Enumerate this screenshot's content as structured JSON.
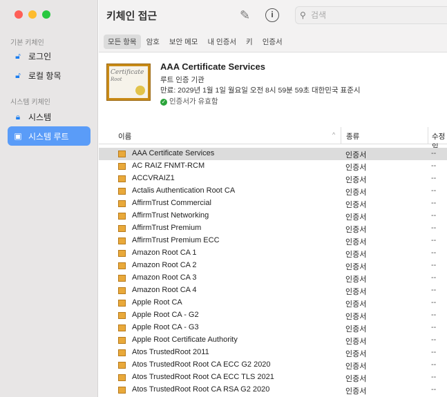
{
  "window": {
    "title": "키체인 접근",
    "search_placeholder": "검색"
  },
  "sidebar": {
    "section1": "기본 키체인",
    "items1": [
      {
        "label": "로그인",
        "icon": "lock-open-icon"
      },
      {
        "label": "로컬 항목",
        "icon": "lock-open-icon"
      }
    ],
    "section2": "시스템 키체인",
    "items2": [
      {
        "label": "시스템",
        "icon": "lock-icon"
      },
      {
        "label": "시스템 루트",
        "icon": "cabinet-icon",
        "selected": true
      }
    ]
  },
  "filters": [
    "모든 항목",
    "암호",
    "보안 메모",
    "내 인증서",
    "키",
    "인증서"
  ],
  "detail": {
    "name": "AAA Certificate Services",
    "kind": "루트 인증 기관",
    "expires": "만료: 2029년 1월 1일 월요일 오전 8시 59분 59초 대한민국 표준시",
    "status": "인증서가 유효함",
    "cert_text1": "Certificate",
    "cert_text2": "Root"
  },
  "table": {
    "columns": [
      "이름",
      "종류",
      "수정일"
    ],
    "rows": [
      [
        "AAA Certificate Services",
        "인증서",
        "--"
      ],
      [
        "AC RAIZ FNMT-RCM",
        "인증서",
        "--"
      ],
      [
        "ACCVRAIZ1",
        "인증서",
        "--"
      ],
      [
        "Actalis Authentication Root CA",
        "인증서",
        "--"
      ],
      [
        "AffirmTrust Commercial",
        "인증서",
        "--"
      ],
      [
        "AffirmTrust Networking",
        "인증서",
        "--"
      ],
      [
        "AffirmTrust Premium",
        "인증서",
        "--"
      ],
      [
        "AffirmTrust Premium ECC",
        "인증서",
        "--"
      ],
      [
        "Amazon Root CA 1",
        "인증서",
        "--"
      ],
      [
        "Amazon Root CA 2",
        "인증서",
        "--"
      ],
      [
        "Amazon Root CA 3",
        "인증서",
        "--"
      ],
      [
        "Amazon Root CA 4",
        "인증서",
        "--"
      ],
      [
        "Apple Root CA",
        "인증서",
        "--"
      ],
      [
        "Apple Root CA - G2",
        "인증서",
        "--"
      ],
      [
        "Apple Root CA - G3",
        "인증서",
        "--"
      ],
      [
        "Apple Root Certificate Authority",
        "인증서",
        "--"
      ],
      [
        "Atos TrustedRoot 2011",
        "인증서",
        "--"
      ],
      [
        "Atos TrustedRoot Root CA ECC G2 2020",
        "인증서",
        "--"
      ],
      [
        "Atos TrustedRoot Root CA ECC TLS 2021",
        "인증서",
        "--"
      ],
      [
        "Atos TrustedRoot Root CA RSA G2 2020",
        "인증서",
        "--"
      ]
    ]
  }
}
